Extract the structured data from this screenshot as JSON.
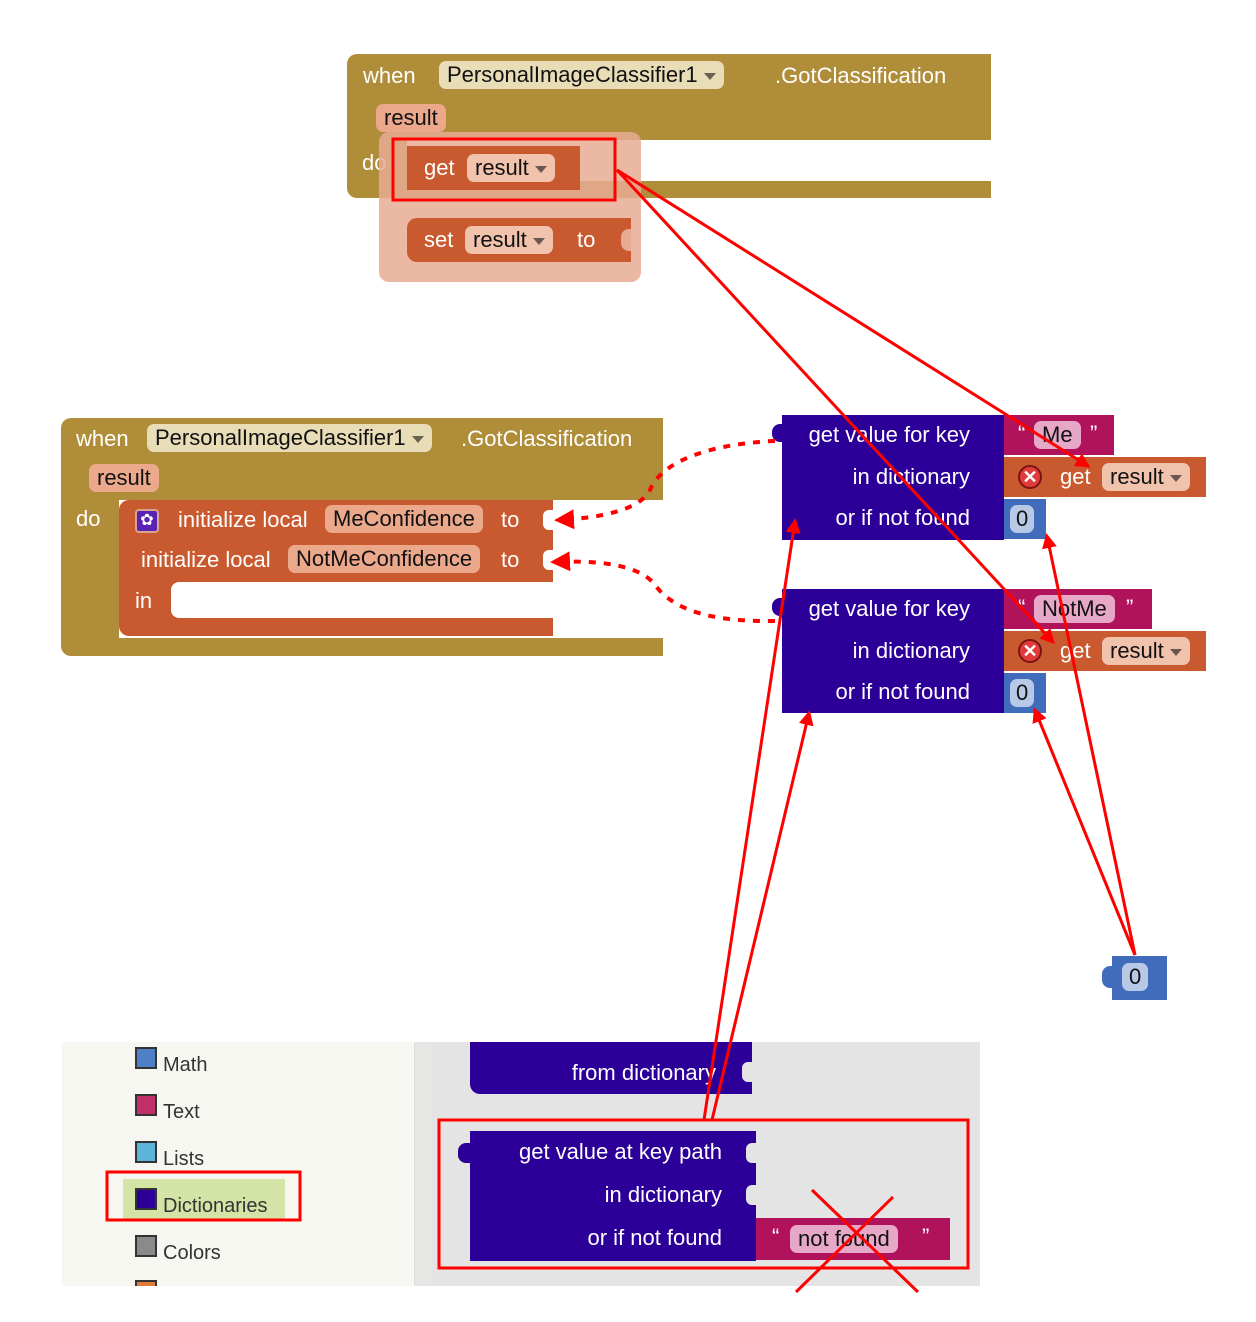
{
  "top_event": {
    "when": "when",
    "component": "PersonalImageClassifier1",
    "event": ".GotClassification",
    "param": "result",
    "do": "do",
    "popup": {
      "get_label": "get",
      "get_var": "result",
      "set_label": "set",
      "set_var": "result",
      "set_to": "to"
    }
  },
  "main_event": {
    "when": "when",
    "component": "PersonalImageClassifier1",
    "event": ".GotClassification",
    "param": "result",
    "do": "do",
    "init1_label": "initialize local",
    "init1_var": "MeConfidence",
    "init1_to": "to",
    "init2_label": "initialize local",
    "init2_var": "NotMeConfidence",
    "init2_to": "to",
    "in_label": "in"
  },
  "dict_blocks": [
    {
      "key_label": "get value for key",
      "key_value": "Me",
      "dict_label": "in dictionary",
      "dict_get": "get",
      "dict_var": "result",
      "notfound_label": "or if not found",
      "notfound_value": "0"
    },
    {
      "key_label": "get value for key",
      "key_value": "NotMe",
      "dict_label": "in dictionary",
      "dict_get": "get",
      "dict_var": "result",
      "notfound_label": "or if not found",
      "notfound_value": "0"
    }
  ],
  "loose_number": "0",
  "quote_open": "“",
  "quote_close": "”",
  "palette": {
    "categories": [
      {
        "label": "Math",
        "color": "#4f7fc6"
      },
      {
        "label": "Text",
        "color": "#c2306a"
      },
      {
        "label": "Lists",
        "color": "#5cb4d9"
      },
      {
        "label": "Dictionaries",
        "color": "#2c0098",
        "selected": true
      },
      {
        "label": "Colors",
        "color": "#8a8a8a"
      }
    ],
    "flyout": {
      "prev_block_label": "from dictionary",
      "keypath_label": "get value at key path",
      "keypath_dict_label": "in dictionary",
      "keypath_notfound_label": "or if not found",
      "keypath_notfound_value": "not found"
    }
  },
  "colors": {
    "annotation": "#ff0000",
    "selected_category_bg": "#d4e4a6"
  }
}
